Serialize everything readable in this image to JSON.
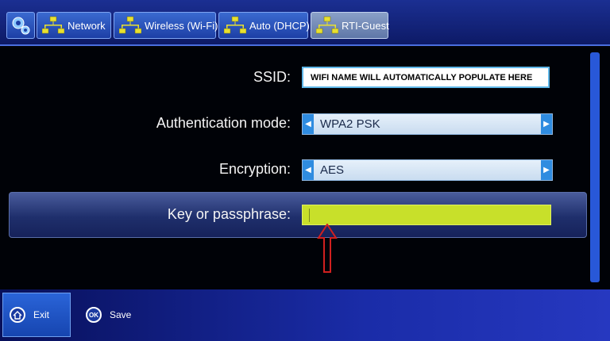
{
  "tabs": {
    "gear": {
      "icon": "gear-icon"
    },
    "network": {
      "label": "Network",
      "icon": "network-icon"
    },
    "wireless": {
      "label": "Wireless (Wi-Fi)",
      "icon": "network-icon"
    },
    "dhcp": {
      "label": "Auto (DHCP)",
      "icon": "network-icon"
    },
    "guest": {
      "label": "RTI-Guest",
      "icon": "network-icon",
      "active": true
    }
  },
  "form": {
    "ssid": {
      "label": "SSID:",
      "value": "WIFI NAME WILL AUTOMATICALLY POPULATE HERE"
    },
    "auth_mode": {
      "label": "Authentication mode:",
      "value": "WPA2 PSK"
    },
    "encryption": {
      "label": "Encryption:",
      "value": "AES"
    },
    "passphrase": {
      "label": "Key or passphrase:",
      "value": ""
    }
  },
  "footer": {
    "exit": {
      "label": "Exit",
      "icon": "home-icon"
    },
    "save": {
      "label": "Save",
      "icon_text": "OK"
    }
  },
  "colors": {
    "tab_bar": "#1b2f92",
    "tab": "#2f5fc8",
    "tab_active": "#7d92bc",
    "passphrase_field": "#c8e02a",
    "select_arrow": "#2f8ce0",
    "annotation_arrow": "#d0201f",
    "scrollbar": "#2858d8"
  }
}
